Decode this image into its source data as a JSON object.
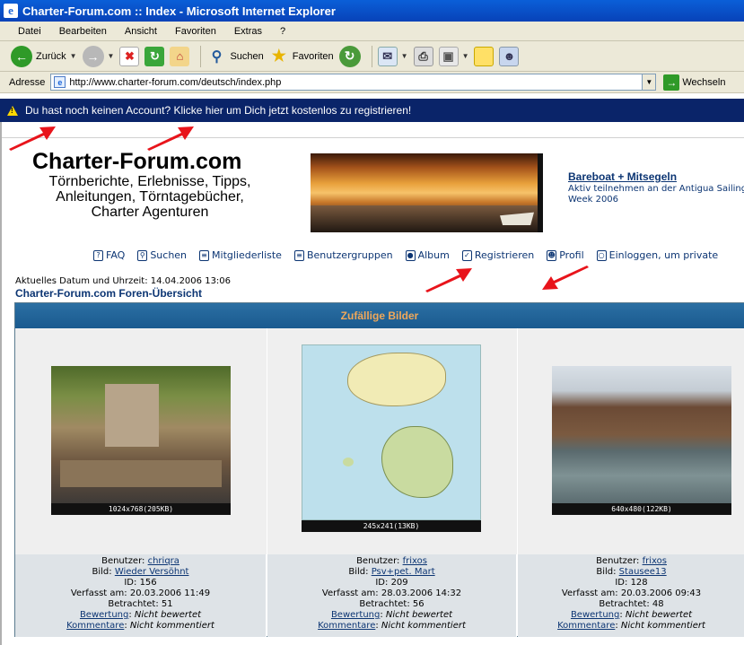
{
  "window": {
    "title": "Charter-Forum.com :: Index - Microsoft Internet Explorer"
  },
  "menu": [
    "Datei",
    "Bearbeiten",
    "Ansicht",
    "Favoriten",
    "Extras",
    "?"
  ],
  "toolbar": {
    "back": "Zurück",
    "search": "Suchen",
    "favorites": "Favoriten"
  },
  "address": {
    "label": "Adresse",
    "url": "http://www.charter-forum.com/deutsch/index.php",
    "go": "Wechseln"
  },
  "infobar": {
    "text": "Du hast noch keinen Account? Klicke hier um Dich jetzt kostenlos zu registrieren!"
  },
  "site": {
    "logo": "Charter-Forum.com",
    "tagline": [
      "Törnberichte, Erlebnisse, Tipps,",
      "Anleitungen, Törntagebücher,",
      "Charter Agenturen"
    ],
    "ad_title": "Bareboat + Mitsegeln",
    "ad_text": [
      "Aktiv teilnehmen an der Antigua Sailing",
      "Week 2006"
    ]
  },
  "nav": [
    "FAQ",
    "Suchen",
    "Mitgliederliste",
    "Benutzergruppen",
    "Album",
    "Registrieren",
    "Profil",
    "Einloggen, um private"
  ],
  "datetime": "Aktuelles Datum und Uhrzeit: 14.04.2006 13:06",
  "forum_title": "Charter-Forum.com Foren-Übersicht",
  "table": {
    "header": "Zufällige Bilder",
    "labels": {
      "user": "Benutzer:",
      "image": "Bild:",
      "id": "ID:",
      "posted": "Verfasst am:",
      "views": "Betrachtet:",
      "rating": "Bewertung",
      "comments": "Kommentare"
    },
    "pictures": [
      {
        "size": "1024x768(205KB)",
        "user": "chriqra",
        "title": "Wieder Versöhnt",
        "id": "156",
        "date": "20.03.2006 11:49",
        "views": "51",
        "rating": "Nicht bewertet",
        "comments": "Nicht kommentiert"
      },
      {
        "size": "245x241(13KB)",
        "user": "frixos",
        "title": "Psv+pet. Mart",
        "id": "209",
        "date": "28.03.2006 14:32",
        "views": "56",
        "rating": "Nicht bewertet",
        "comments": "Nicht kommentiert"
      },
      {
        "size": "640x480(122KB)",
        "user": "frixos",
        "title": "Stausee13",
        "id": "128",
        "date": "20.03.2006 09:43",
        "views": "48",
        "rating": "Nicht bewertet",
        "comments": "Nicht kommentiert"
      }
    ]
  }
}
